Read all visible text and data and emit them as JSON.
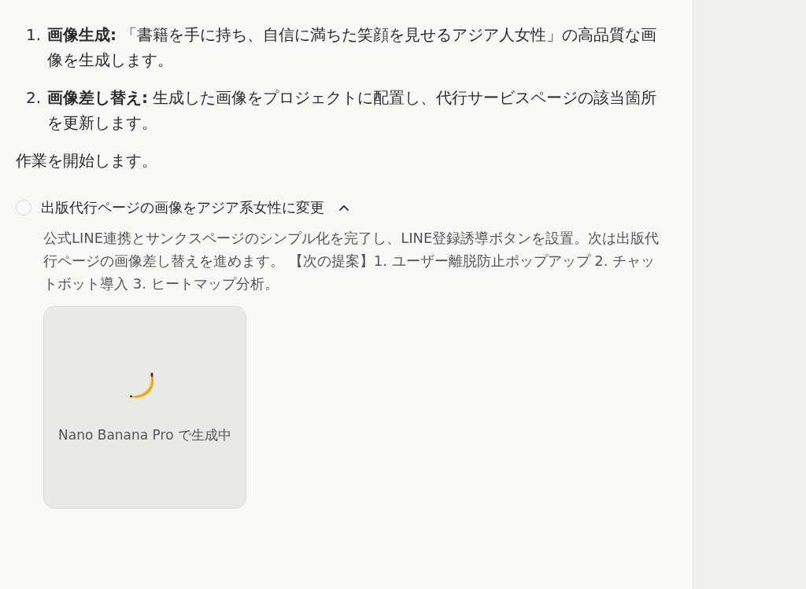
{
  "steps": [
    {
      "number": "1.",
      "text": "**画像生成:** 「書籍を手に持ち、自信に満ちた笑顔を見せるアジア人女性」の高品質な画像を生成します。"
    },
    {
      "number": "2.",
      "text": "**画像差し替え:** 生成した画像をプロジェクトに配置し、代行サービスページの該当箇所を更新します。"
    }
  ],
  "status_message": "作業を開始します。",
  "task": {
    "title": "出版代行ページの画像をアジア系女性に変更",
    "done": false,
    "expanded": true,
    "description": "公式LINE連携とサンクスページのシンプル化を完了し、LINE登録誘導ボタンを設置。次は出版代行ページの画像差し替えを進めます。 【次の提案】1. ユーザー離脱防止ポップアップ 2. チャットボット導入 3. ヒートマップ分析。",
    "generation_card": {
      "label": "Nano Banana Pro で生成中"
    }
  }
}
